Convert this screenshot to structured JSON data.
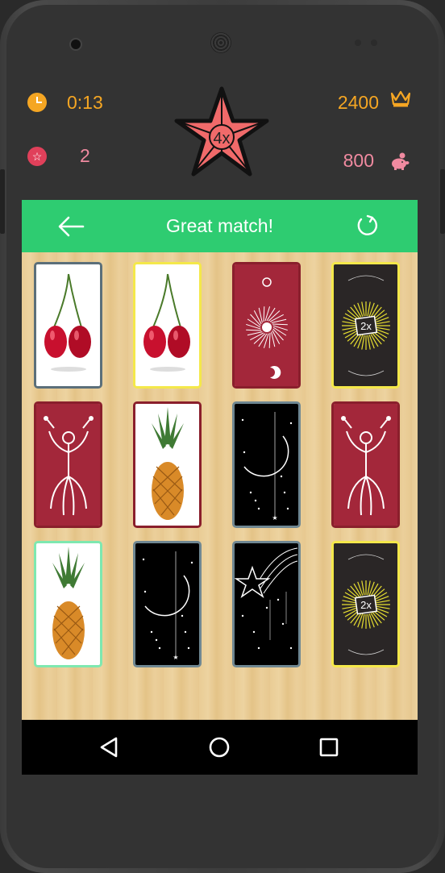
{
  "hud": {
    "time": "0:13",
    "level": "2",
    "score": "2400",
    "coins": "800",
    "multiplier": "4x"
  },
  "topbar": {
    "message": "Great match!"
  },
  "cards": [
    {
      "face": "cherries",
      "border": "#5b6f7a"
    },
    {
      "face": "cherries",
      "border": "#f4e84a"
    },
    {
      "face": "sun-moon-back",
      "border": "#8a1f2c"
    },
    {
      "face": "2x-bonus",
      "border": "#f4e84a",
      "label": "2x"
    },
    {
      "face": "dancer-back",
      "border": "#8a1f2c"
    },
    {
      "face": "pineapple",
      "border": "#8a1f2c"
    },
    {
      "face": "crescent-moon-back",
      "border": "#6f8792"
    },
    {
      "face": "dancer-back",
      "border": "#8a1f2c"
    },
    {
      "face": "pineapple",
      "border": "#7ee8b0"
    },
    {
      "face": "crescent-moon-back",
      "border": "#6f8792"
    },
    {
      "face": "shooting-star-back",
      "border": "#6f8792"
    },
    {
      "face": "2x-bonus",
      "border": "#f4e84a",
      "label": "2x"
    }
  ],
  "colors": {
    "accent_green": "#2ecc71",
    "hud_orange": "#f5a623",
    "hud_pink": "#f08aa0",
    "hud_bg": "#333333"
  }
}
